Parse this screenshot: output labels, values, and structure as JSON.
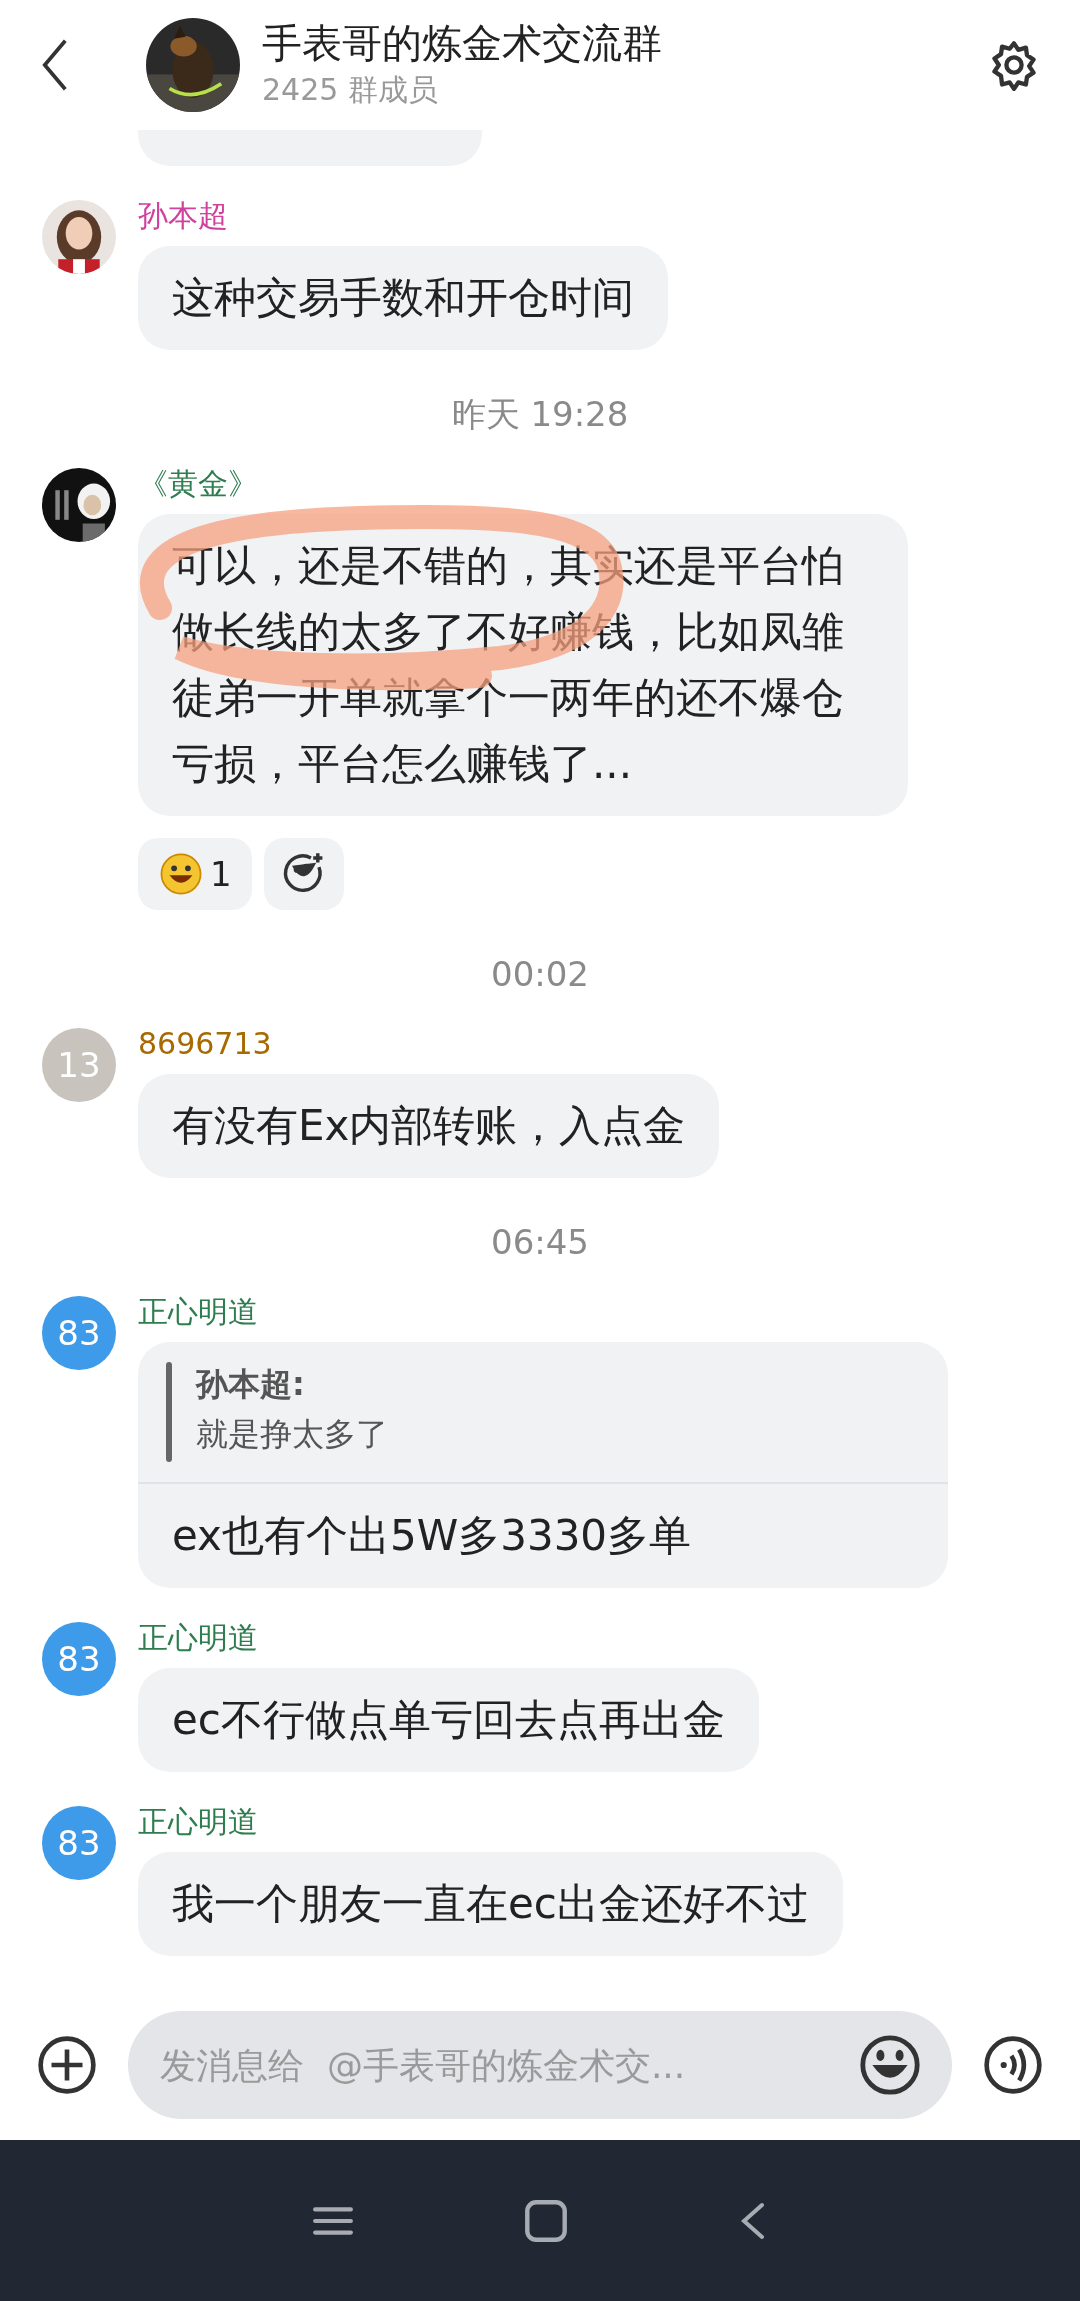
{
  "header": {
    "title": "手表哥的炼金术交流群",
    "members": "2425 群成员"
  },
  "messages": [
    {
      "kind": "partial"
    },
    {
      "kind": "message",
      "sender": "孙本超",
      "color": "#d0419e",
      "text": "这种交易手数和开仓时间"
    },
    {
      "kind": "time",
      "text": "昨天 19:28"
    },
    {
      "kind": "message",
      "sender": "《黄金》",
      "color": "#2e7d4f",
      "text": "可以，还是不错的，其实还是平台怕做长线的太多了不好赚钱，比如凤雏徒弟一开单就拿个一两年的还不爆仓亏损，平台怎么赚钱了...",
      "highlighted": true,
      "reactions": [
        {
          "kind": "emoji",
          "count": "1"
        },
        {
          "kind": "add"
        }
      ]
    },
    {
      "kind": "time",
      "text": "00:02"
    },
    {
      "kind": "message",
      "sender": "8696713",
      "color": "#a86a00",
      "avatar": {
        "kind": "initials",
        "text": "13",
        "color": "#c9c3bd"
      },
      "text": "有没有Ex内部转账，入点金"
    },
    {
      "kind": "time",
      "text": "06:45"
    },
    {
      "kind": "message",
      "sender": "正心明道",
      "color": "#2e7d4f",
      "avatar": {
        "kind": "initials",
        "text": "83",
        "color": "#3d9be9"
      },
      "quote": {
        "sender": "孙本超:",
        "text": "就是挣太多了"
      },
      "text": "ex也有个出5W多3330多单"
    },
    {
      "kind": "message",
      "sender": "正心明道",
      "color": "#2e7d4f",
      "avatar": {
        "kind": "initials",
        "text": "83",
        "color": "#3d9be9"
      },
      "text": "ec不行做点单亏回去点再出金"
    },
    {
      "kind": "message",
      "sender": "正心明道",
      "color": "#2e7d4f",
      "avatar": {
        "kind": "initials",
        "text": "83",
        "color": "#3d9be9"
      },
      "text": "我一个朋友一直在ec出金还好不过"
    }
  ],
  "composer": {
    "placeholder": "发消息给  @手表哥的炼金术交..."
  }
}
